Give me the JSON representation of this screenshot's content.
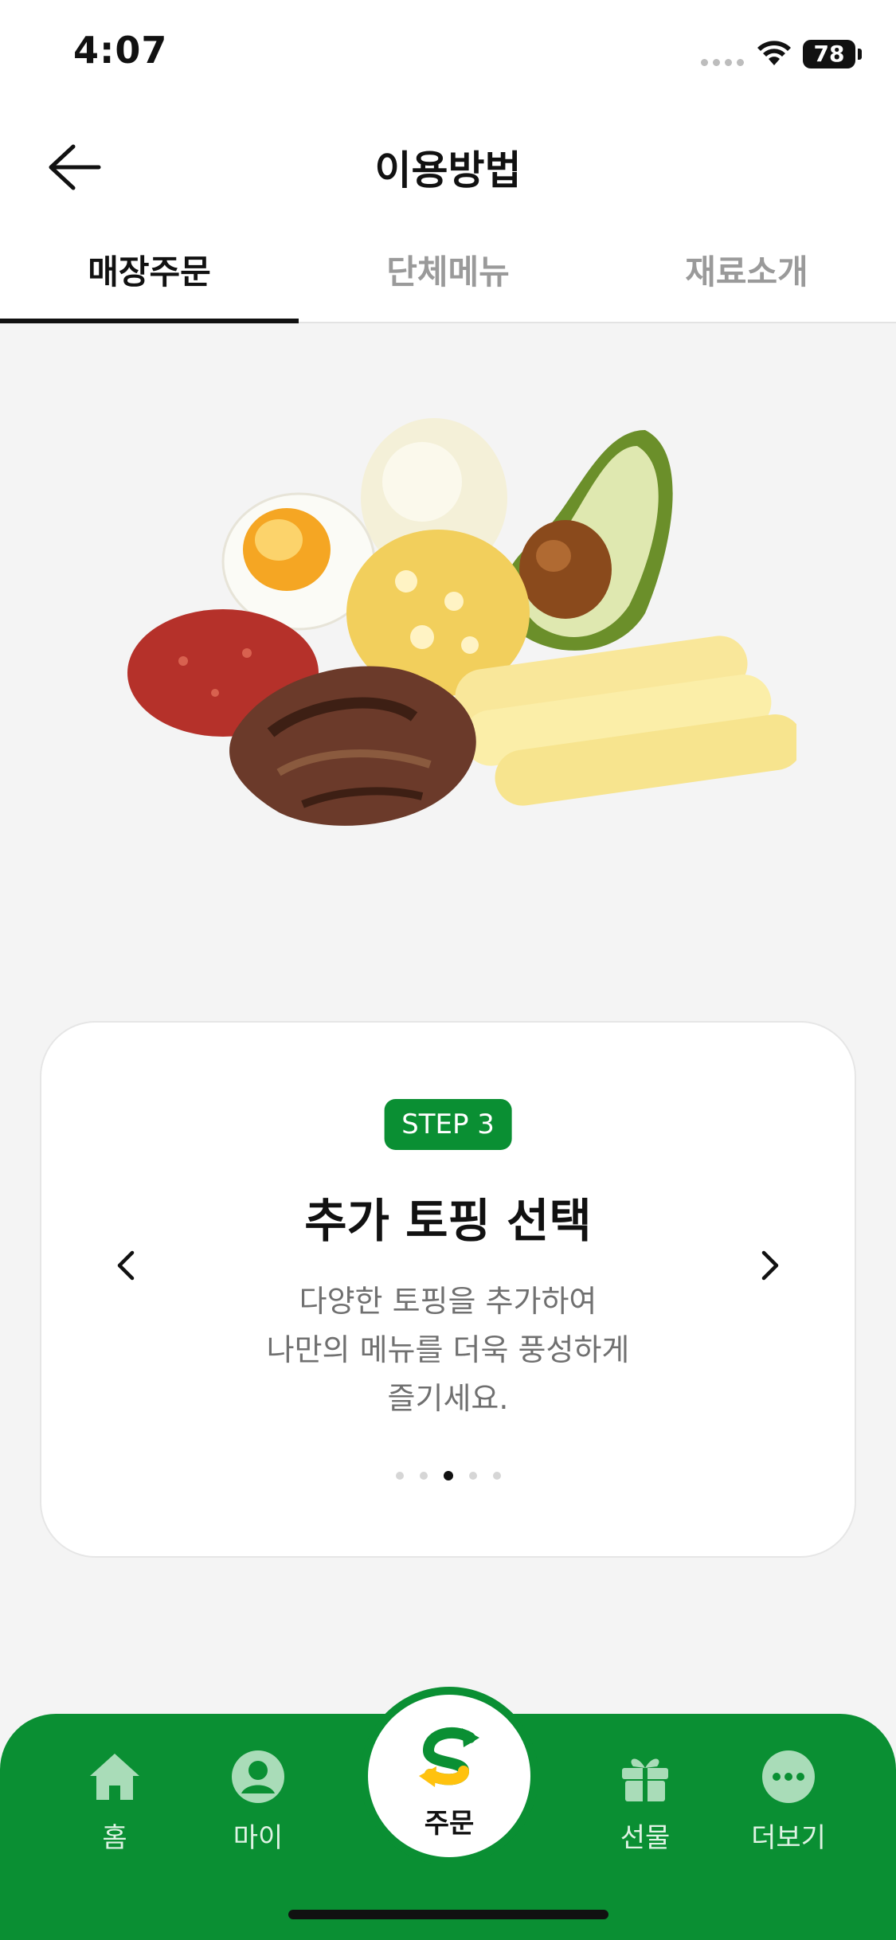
{
  "status": {
    "time": "4:07",
    "battery": "78"
  },
  "header": {
    "title": "이용방법"
  },
  "tabs": [
    {
      "label": "매장주문",
      "active": true
    },
    {
      "label": "단체메뉴",
      "active": false
    },
    {
      "label": "재료소개",
      "active": false
    }
  ],
  "card": {
    "step": "STEP 3",
    "title": "추가 토핑 선택",
    "description": [
      "다양한 토핑을 추가하여",
      "나만의 메뉴를 더욱 풍성하게",
      "즐기세요."
    ],
    "pagination": {
      "total": 5,
      "current": 3
    }
  },
  "nav": {
    "items": [
      {
        "label": "홈",
        "icon": "home-icon"
      },
      {
        "label": "마이",
        "icon": "profile-icon"
      },
      {
        "label": "주문",
        "icon": "subway-logo-icon"
      },
      {
        "label": "선물",
        "icon": "gift-icon"
      },
      {
        "label": "더보기",
        "icon": "more-icon"
      }
    ]
  },
  "colors": {
    "brand_green": "#0a8f33",
    "accent_yellow": "#ffc20e"
  }
}
